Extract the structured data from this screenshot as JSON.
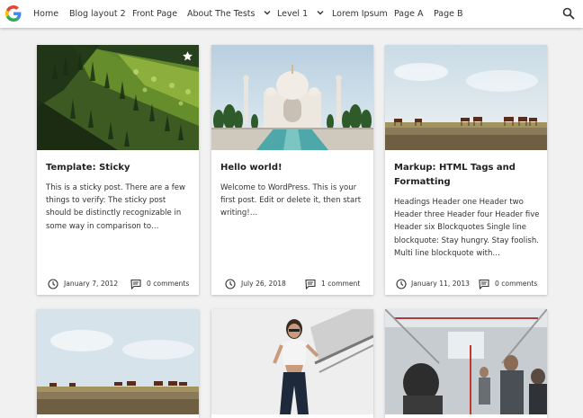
{
  "nav": {
    "items": [
      {
        "label": "Home"
      },
      {
        "label": "Blog layout 2"
      },
      {
        "label": "Front Page"
      },
      {
        "label": "About The Tests"
      },
      {
        "label": "Level 1"
      },
      {
        "label": "Lorem Ipsum"
      },
      {
        "label": "Page A"
      },
      {
        "label": "Page B"
      }
    ],
    "logo_icon": "google-g-icon",
    "search_icon": "search-icon",
    "colors": {
      "blue": "#4285F4",
      "red": "#EA4335",
      "yellow": "#FBBC05",
      "green": "#34A853"
    }
  },
  "posts": [
    {
      "title": "Template: Sticky",
      "excerpt": "This is a sticky post. There are a few things to verify: The sticky post should be distinctly recognizable in some way in comparison to…",
      "date": "January 7, 2012",
      "comments": "0 comments",
      "sticky": true,
      "image": "forest-hillside"
    },
    {
      "title": "Hello world!",
      "excerpt": "Welcome to WordPress. This is your first post. Edit or delete it, then start writing!…",
      "date": "July 26, 2018",
      "comments": "1 comment",
      "sticky": false,
      "image": "taj-mahal"
    },
    {
      "title": "Markup: HTML Tags and Formatting",
      "excerpt": "Headings Header one Header two Header three Header four Header five Header six Blockquotes Single line blockquote: Stay hungry. Stay foolish. Multi line blockquote with…",
      "date": "January 11, 2013",
      "comments": "0 comments",
      "sticky": false,
      "image": "horses-plain"
    }
  ],
  "posts_row2": [
    {
      "image": "horses-plain"
    },
    {
      "image": "woman-railing"
    },
    {
      "image": "bus-interior"
    }
  ],
  "icons": {
    "date": "clock-icon",
    "comments": "comment-icon",
    "sticky": "star-icon"
  }
}
